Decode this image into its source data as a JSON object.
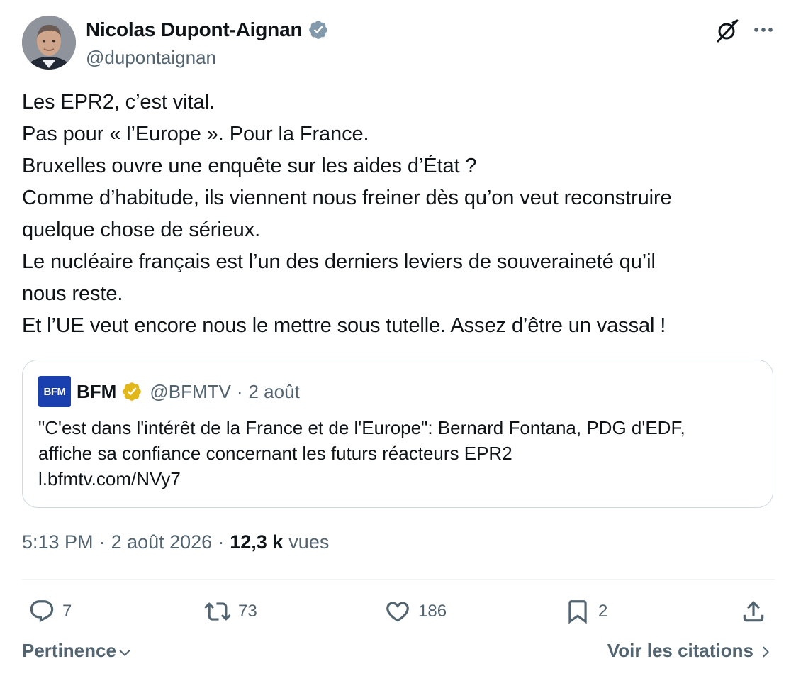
{
  "author": {
    "name": "Nicolas Dupont-Aignan",
    "handle": "@dupontaignan",
    "verified_badge_color": "#829aab"
  },
  "tweet": {
    "lines": [
      "Les EPR2, c’est vital.",
      "Pas pour « l’Europe ». Pour la France.",
      "Bruxelles ouvre une enquête sur les aides d’État ?",
      "Comme d’habitude, ils viennent nous freiner dès qu’on veut reconstruire",
      "quelque chose de sérieux.",
      "Le nucléaire français est l’un des derniers leviers de souveraineté qu’il",
      "nous reste.",
      "Et l’UE veut encore nous le mettre sous tutelle. Assez d’être un vassal !"
    ]
  },
  "quote": {
    "logo_text": "BFM",
    "name": "BFM",
    "handle": "@BFMTV",
    "separator": "·",
    "date": "2 août",
    "badge_color": "#e2b719",
    "body_lines": [
      "\"C'est dans l'intérêt de la France et de l'Europe\": Bernard Fontana, PDG d'EDF,",
      "affiche sa confiance concernant les futurs réacteurs EPR2",
      "l.bfmtv.com/NVy7"
    ]
  },
  "meta": {
    "time": "5:13 PM",
    "separator": "·",
    "date": "2 août 2026",
    "views_count": "12,3 k",
    "views_label": "vues"
  },
  "actions": {
    "replies": "7",
    "retweets": "73",
    "likes": "186",
    "bookmarks": "2"
  },
  "footer": {
    "sort_label": "Pertinence",
    "quotes_label": "Voir les citations"
  },
  "icons": {
    "verified": "verified-badge-icon",
    "grok": "grok-icon",
    "more": "more-icon",
    "reply": "reply-icon",
    "retweet": "retweet-icon",
    "like": "heart-icon",
    "bookmark": "bookmark-icon",
    "share": "share-icon",
    "chevron_down": "chevron-down-icon",
    "chevron_right": "chevron-right-icon"
  },
  "colors": {
    "text": "#0f1419",
    "secondary": "#536471",
    "border": "#cfd9de",
    "bfm_blue": "#1a3fae"
  }
}
